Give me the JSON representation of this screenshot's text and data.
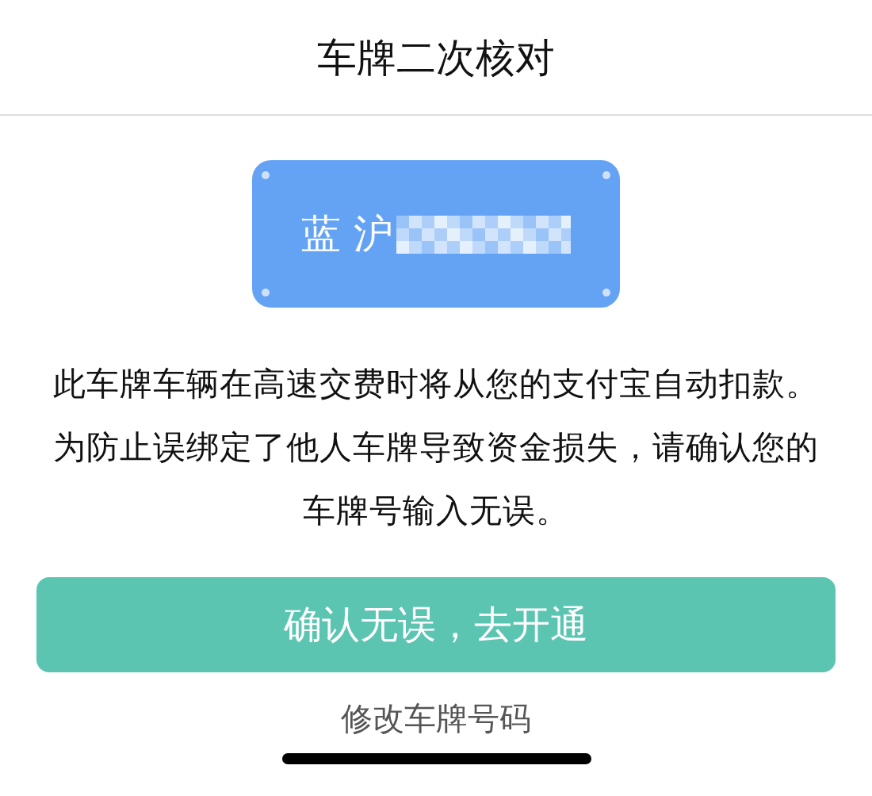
{
  "header": {
    "title": "车牌二次核对"
  },
  "plate": {
    "text": "蓝 沪"
  },
  "message_lines": [
    "此车牌车辆在高速交费时将从您的支付宝自动扣款。",
    "为防止误绑定了他人车牌导致资金损失，请确认您的",
    "车牌号输入无误。"
  ],
  "confirm_button": "确认无误，去开通",
  "edit_link": "修改车牌号码"
}
